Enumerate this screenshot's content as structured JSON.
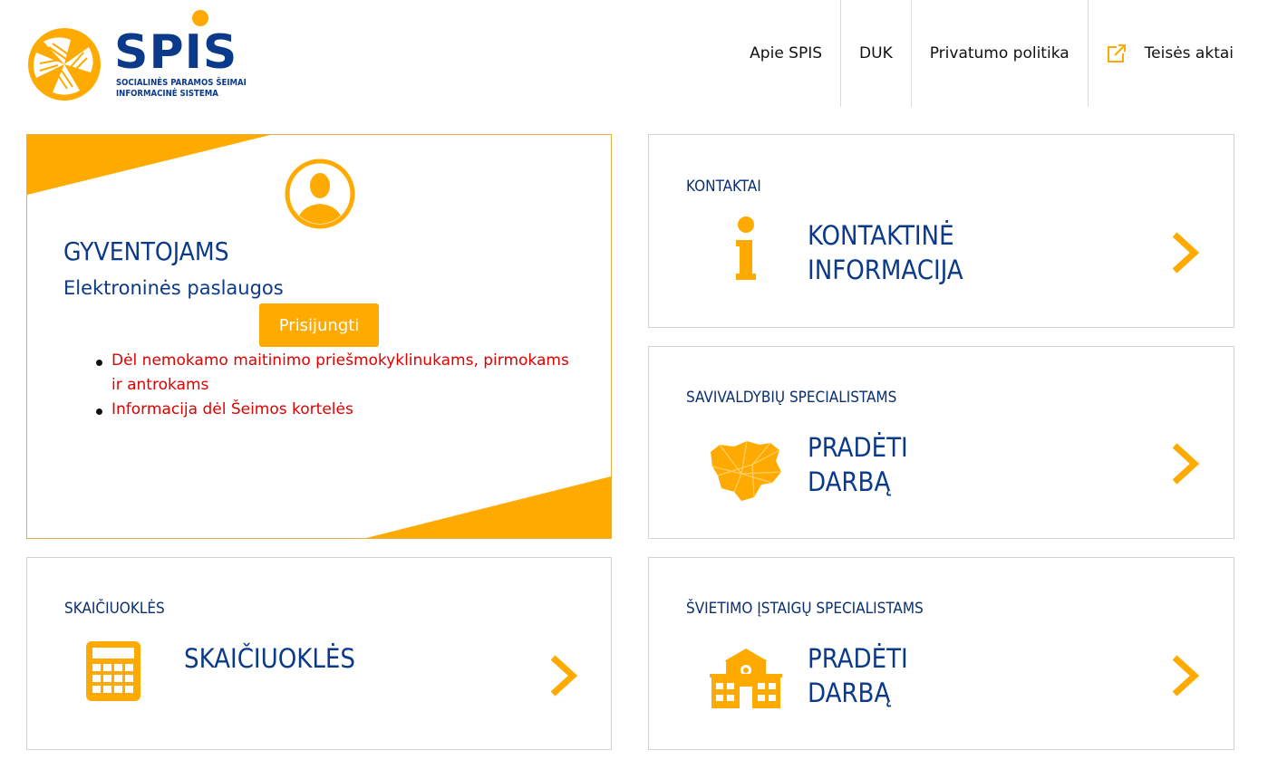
{
  "header": {
    "logo_word": "SPIS",
    "logo_line1": "SOCIALINĖS PARAMOS ŠEIMAI",
    "logo_line2": "INFORMACINĖ SISTEMA",
    "nav": [
      "Apie SPIS",
      "DUK",
      "Privatumo politika",
      "Teisės aktai"
    ]
  },
  "residents": {
    "title": "GYVENTOJAMS",
    "subtitle": "Elektroninės paslaugos",
    "login_label": "Prisijungti",
    "links": [
      {
        "line1": "Dėl nemokamo maitinimo priešmokyklinukams, pirmokams",
        "line2": "ir antrokams"
      },
      {
        "line1": "Informacija dėl Šeimos kortelės"
      }
    ]
  },
  "contacts": {
    "label": "KONTAKTAI",
    "title_line1": "KONTAKTINĖ",
    "title_line2": "INFORMACIJA"
  },
  "municipal": {
    "label": "SAVIVALDYBIŲ SPECIALISTAMS",
    "title_line1": "PRADĖTI",
    "title_line2": "DARBĄ"
  },
  "calculators": {
    "label": "SKAIČIUOKLĖS",
    "title_line1": "SKAIČIUOKLĖS"
  },
  "education": {
    "label": "ŠVIETIMO ĮSTAIGŲ SPECIALISTAMS",
    "title_line1": "PRADĖTI",
    "title_line2": "DARBĄ"
  },
  "colors": {
    "accent": "#ffaa00",
    "brand": "#0b3a8a",
    "link_red": "#e00000"
  }
}
